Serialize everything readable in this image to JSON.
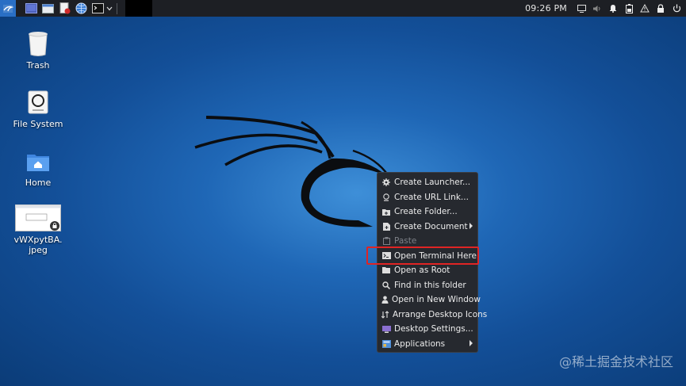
{
  "panel": {
    "clock": "09:26 PM"
  },
  "desktop": {
    "icons": [
      {
        "label": "Trash"
      },
      {
        "label": "File System"
      },
      {
        "label": "Home"
      },
      {
        "label": "vWXpytBA.jpeg"
      }
    ]
  },
  "context_menu": {
    "items": [
      {
        "label": "Create Launcher...",
        "icon": "gear-icon"
      },
      {
        "label": "Create URL Link...",
        "icon": "link-icon"
      },
      {
        "label": "Create Folder...",
        "icon": "folder-plus-icon"
      },
      {
        "label": "Create Document",
        "icon": "document-icon",
        "submenu": true
      },
      {
        "label": "Paste",
        "icon": "paste-icon",
        "disabled": true
      },
      {
        "label": "Open Terminal Here",
        "icon": "terminal-icon",
        "highlighted": true
      },
      {
        "label": "Open as Root",
        "icon": "folder-icon"
      },
      {
        "label": "Find in this folder",
        "icon": "search-icon"
      },
      {
        "label": "Open in New Window",
        "icon": "user-icon"
      },
      {
        "label": "Arrange Desktop Icons",
        "icon": "arrange-icon"
      },
      {
        "label": "Desktop Settings...",
        "icon": "monitor-icon"
      },
      {
        "label": "Applications",
        "icon": "applications-icon",
        "submenu": true
      }
    ]
  },
  "watermark": "@稀土掘金技术社区",
  "colors": {
    "highlight_border": "#e02424",
    "panel_bg": "#1d1f24",
    "menu_bg": "#26292f"
  }
}
